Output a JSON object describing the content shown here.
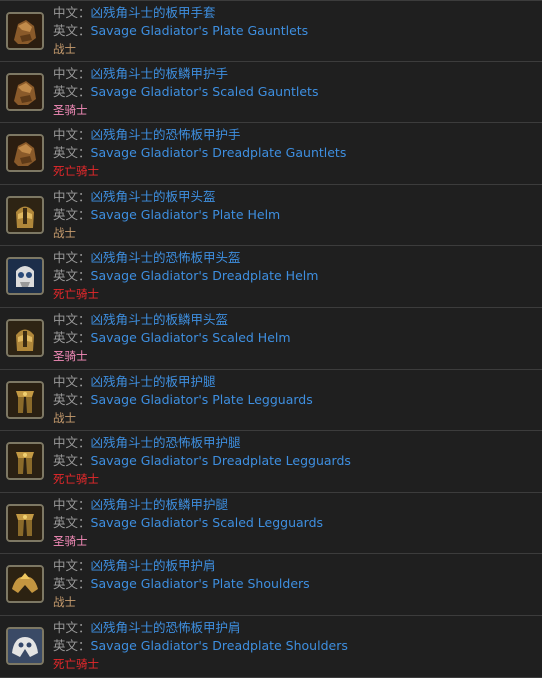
{
  "labels": {
    "zh": "中文：",
    "en": "英文："
  },
  "classColors": {
    "战士": "#c79c6e",
    "圣骑士": "#f58cba",
    "死亡骑士": "#e8282b"
  },
  "items": [
    {
      "zh": "凶残角斗士的板甲手套",
      "en": "Savage Gladiator's Plate Gauntlets",
      "cls": "战士",
      "icon": "gauntlets-icon"
    },
    {
      "zh": "凶残角斗士的板鳞甲护手",
      "en": "Savage Gladiator's Scaled Gauntlets",
      "cls": "圣骑士",
      "icon": "gauntlets-icon"
    },
    {
      "zh": "凶残角斗士的恐怖板甲护手",
      "en": "Savage Gladiator's Dreadplate Gauntlets",
      "cls": "死亡骑士",
      "icon": "gauntlets-icon"
    },
    {
      "zh": "凶残角斗士的板甲头盔",
      "en": "Savage Gladiator's Plate Helm",
      "cls": "战士",
      "icon": "helm-icon"
    },
    {
      "zh": "凶残角斗士的恐怖板甲头盔",
      "en": "Savage Gladiator's Dreadplate Helm",
      "cls": "死亡骑士",
      "icon": "skull-helm-icon"
    },
    {
      "zh": "凶残角斗士的板鳞甲头盔",
      "en": "Savage Gladiator's Scaled Helm",
      "cls": "圣骑士",
      "icon": "helm-icon"
    },
    {
      "zh": "凶残角斗士的板甲护腿",
      "en": "Savage Gladiator's Plate Legguards",
      "cls": "战士",
      "icon": "legguards-icon"
    },
    {
      "zh": "凶残角斗士的恐怖板甲护腿",
      "en": "Savage Gladiator's Dreadplate Legguards",
      "cls": "死亡骑士",
      "icon": "legguards-icon"
    },
    {
      "zh": "凶残角斗士的板鳞甲护腿",
      "en": "Savage Gladiator's Scaled Legguards",
      "cls": "圣骑士",
      "icon": "legguards-icon"
    },
    {
      "zh": "凶残角斗士的板甲护肩",
      "en": "Savage Gladiator's Plate Shoulders",
      "cls": "战士",
      "icon": "shoulders-icon"
    },
    {
      "zh": "凶残角斗士的恐怖板甲护肩",
      "en": "Savage Gladiator's Dreadplate Shoulders",
      "cls": "死亡骑士",
      "icon": "skull-shoulders-icon"
    }
  ]
}
